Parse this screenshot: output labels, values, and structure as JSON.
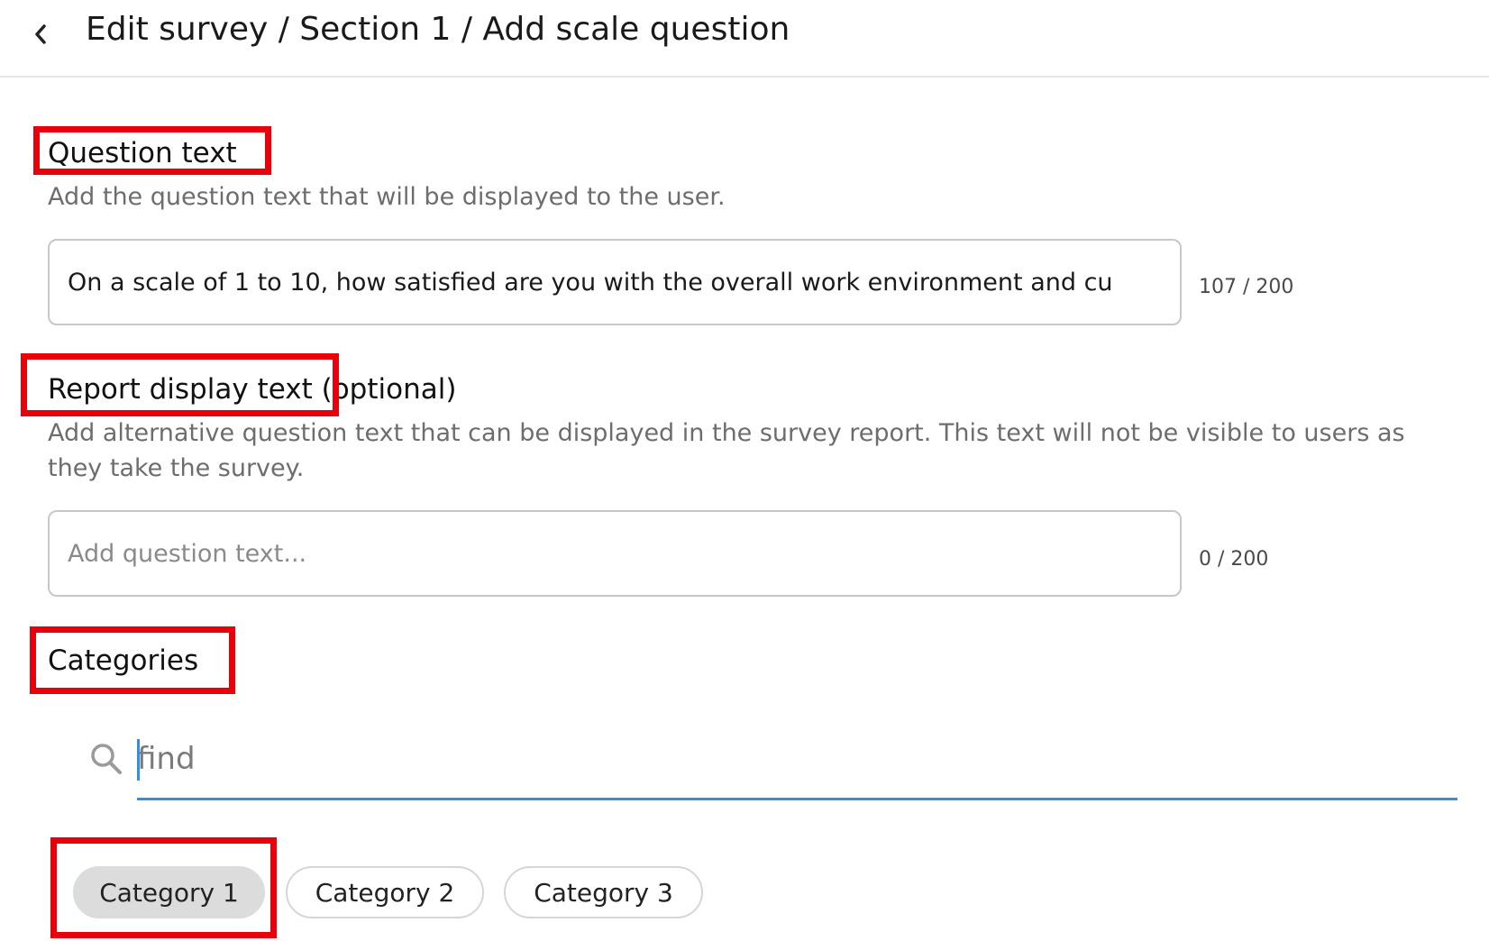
{
  "header": {
    "title": "Edit survey / Section 1 / Add scale question"
  },
  "question_text": {
    "title": "Question text",
    "hint": "Add the question text that will be displayed to the user.",
    "value": "On a scale of 1 to 10, how satisfied are you with the overall work environment and cu",
    "counter": "107 / 200"
  },
  "report_display_text": {
    "title": "Report display text",
    "optional": "(optional)",
    "hint": "Add alternative question text that can be displayed in the survey report. This text will not be visible to users as they take the survey.",
    "placeholder": "Add question text...",
    "counter": "0 / 200"
  },
  "categories": {
    "title": "Categories",
    "search_placeholder": "find",
    "items": [
      {
        "label": "Category 1",
        "selected": true
      },
      {
        "label": "Category 2",
        "selected": false
      },
      {
        "label": "Category 3",
        "selected": false
      }
    ]
  },
  "colors": {
    "highlight_box": "#e8000b",
    "search_underline": "#2f8fe6",
    "selected_chip": "#dcdcdc"
  }
}
